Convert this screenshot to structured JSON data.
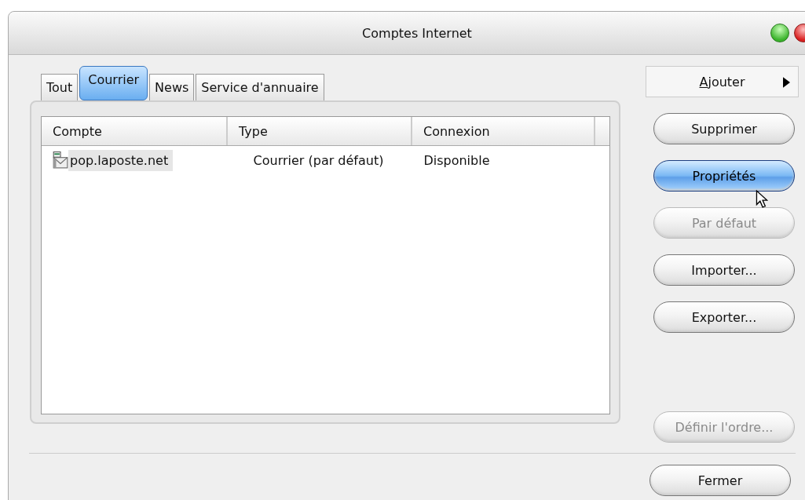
{
  "window": {
    "title": "Comptes Internet"
  },
  "tabs": [
    {
      "label": "Tout",
      "selected": false
    },
    {
      "label": "Courrier",
      "selected": true
    },
    {
      "label": "News",
      "selected": false
    },
    {
      "label": "Service d'annuaire",
      "selected": false
    }
  ],
  "table": {
    "columns": [
      "Compte",
      "Type",
      "Connexion"
    ],
    "rows": [
      {
        "cells": [
          "pop.laposte.net",
          "Courrier (par défaut)",
          "Disponible"
        ],
        "selected": true
      }
    ]
  },
  "buttons": [
    {
      "label": "Ajouter",
      "kind": "menu",
      "default": false,
      "disabled": false
    },
    {
      "label": "Supprimer",
      "kind": "pill",
      "default": false,
      "disabled": false
    },
    {
      "label": "Propriétés",
      "kind": "pill",
      "default": true,
      "disabled": false
    },
    {
      "label": "Par défaut",
      "kind": "pill",
      "default": false,
      "disabled": true
    },
    {
      "label": "Importer...",
      "kind": "pill",
      "default": false,
      "disabled": false
    },
    {
      "label": "Exporter...",
      "kind": "pill",
      "default": false,
      "disabled": false
    },
    {
      "label": "Définir l'ordre...",
      "kind": "pill",
      "default": false,
      "disabled": true
    }
  ],
  "footer_buttons": [
    {
      "label": "Fermer",
      "kind": "pill",
      "default": false,
      "disabled": false
    }
  ]
}
